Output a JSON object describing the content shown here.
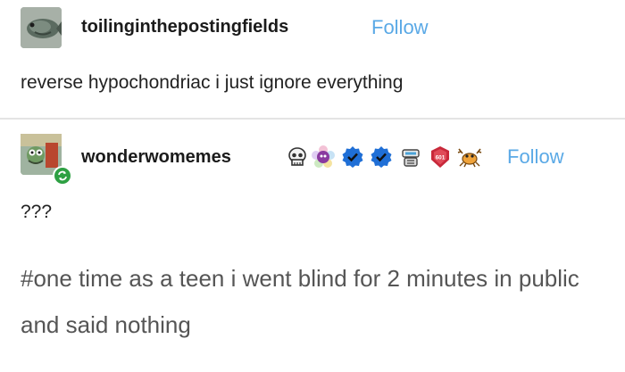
{
  "posts": [
    {
      "username": "toilinginthepostingfields",
      "follow_label": "Follow",
      "body": "reverse hypochondriac i just ignore everything",
      "avatar_icon": "fish-avatar"
    },
    {
      "username": "wonderwomemes",
      "follow_label": "Follow",
      "body": "???",
      "tag_line": "#one time as a teen i went blind for 2 minutes in public and said nothing",
      "avatar_icon": "cartoon-avatar",
      "badges": [
        {
          "name": "skull-badge-icon"
        },
        {
          "name": "flower-badge-icon"
        },
        {
          "name": "verified-badge-icon"
        },
        {
          "name": "verified-badge-icon"
        },
        {
          "name": "robot-badge-icon"
        },
        {
          "name": "shield-badge-icon",
          "text": "601"
        },
        {
          "name": "crab-badge-icon"
        }
      ]
    }
  ],
  "colors": {
    "follow": "#5aa9e6",
    "divider": "#e4e4e4",
    "verified": "#1f6fd6",
    "recip": "#2ea043"
  }
}
